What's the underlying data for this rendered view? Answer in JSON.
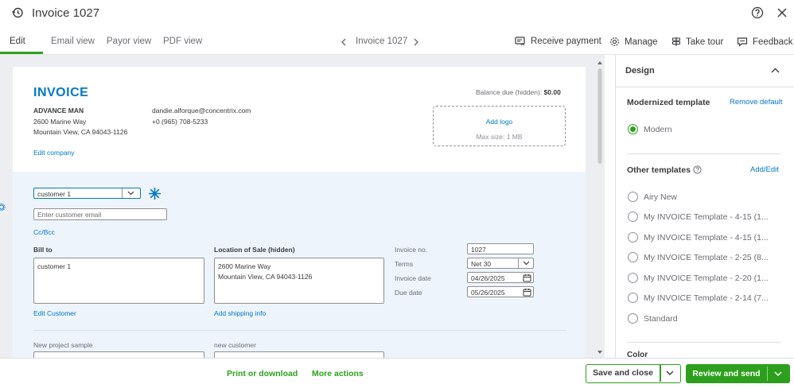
{
  "header": {
    "title": "Invoice 1027",
    "tabs": [
      "Edit",
      "Email view",
      "Payor view",
      "PDF view"
    ],
    "nav_label": "Invoice 1027",
    "actions": {
      "receive_payment": "Receive payment",
      "manage": "Manage",
      "take_tour": "Take tour",
      "feedback": "Feedback"
    }
  },
  "invoice": {
    "heading": "INVOICE",
    "company_name": "ADVANCE MAN",
    "address_line1": "2600 Marine Way",
    "address_line2": "Mountain View, CA 94043-1126",
    "email": "dandie.alforque@concentrix.com",
    "phone": "+0 (965) 708-5233",
    "edit_company": "Edit company",
    "balance_label": "Balance due (hidden):",
    "balance_value": "$0.00",
    "add_logo": "Add logo",
    "logo_hint": "Max size: 1 MB",
    "customer_value": "customer 1",
    "email_placeholder": "Enter customer email",
    "cc_bcc": "Cc/Bcc",
    "bill_to_label": "Bill to",
    "bill_to_value": "customer 1",
    "edit_customer": "Edit Customer",
    "location_label": "Location of Sale (hidden)",
    "location_line1": "2600 Marine Way",
    "location_line2": "Mountain View, CA 94043-1126",
    "add_shipping": "Add shipping info",
    "invoice_no_label": "Invoice no.",
    "invoice_no_value": "1027",
    "terms_label": "Terms",
    "terms_value": "Net 30",
    "invoice_date_label": "Invoice date",
    "invoice_date_value": "04/26/2025",
    "due_date_label": "Due date",
    "due_date_value": "05/26/2025",
    "project_label": "New project sample",
    "new_customer_label": "new customer"
  },
  "design_panel": {
    "title": "Design",
    "modernized_label": "Modernized template",
    "remove_default": "Remove default",
    "selected_template": "Modern",
    "other_label": "Other templates",
    "add_edit": "Add/Edit",
    "templates": [
      "Airy New",
      "My INVOICE Template - 4-15 (1...",
      "My INVOICE Template - 4-15 (1...",
      "My INVOICE Template - 2-25 (8...",
      "My INVOICE Template - 2-20 (1...",
      "My INVOICE Template - 2-14 (7...",
      "Standard"
    ],
    "color_label": "Color"
  },
  "footer": {
    "print_download": "Print or download",
    "more_actions": "More actions",
    "save_close": "Save and close",
    "review_send": "Review and send"
  },
  "colors": {
    "brand_green": "#2ca01c",
    "link_blue": "#0077c5",
    "invoice_blue": "#0077c5"
  }
}
